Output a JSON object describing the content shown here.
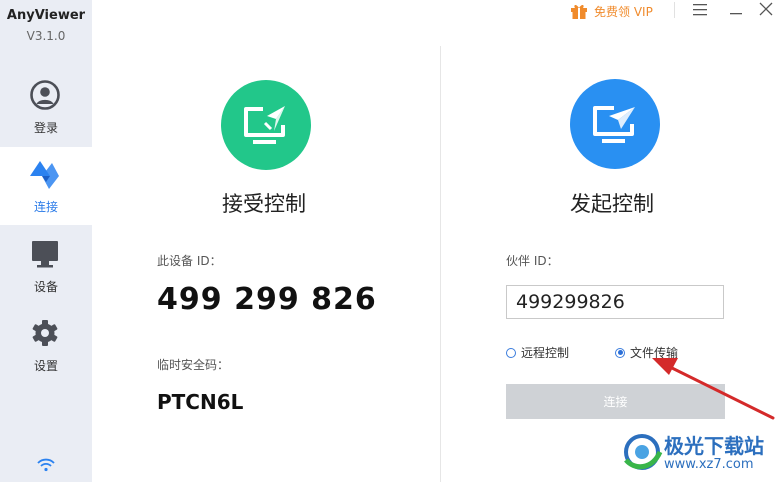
{
  "app": {
    "name": "AnyViewer",
    "version": "V3.1.0"
  },
  "topbar": {
    "vip_label": "免费领 VIP"
  },
  "sidebar": {
    "items": [
      {
        "label": "登录",
        "icon": "user-icon"
      },
      {
        "label": "连接",
        "icon": "connect-icon"
      },
      {
        "label": "设备",
        "icon": "monitor-icon"
      },
      {
        "label": "设置",
        "icon": "gear-icon"
      }
    ],
    "active": "连接"
  },
  "receive": {
    "title": "接受控制",
    "device_id_label": "此设备 ID：",
    "device_id": "499 299 826",
    "temp_code_label": "临时安全码：",
    "temp_code": "PTCN6L"
  },
  "initiate": {
    "title": "发起控制",
    "partner_id_label": "伙伴 ID：",
    "partner_id_value": "499299826",
    "options": [
      {
        "label": "远程控制",
        "selected": false
      },
      {
        "label": "文件传输",
        "selected": true
      }
    ],
    "connect_label": "连接"
  },
  "watermark": {
    "title": "极光下载站",
    "url": "www.xz7.com"
  },
  "colors": {
    "green": "#22c78a",
    "blue": "#2990f2",
    "accent": "#2b7be8",
    "vip": "#f08b2c",
    "arrow": "#d42a2a"
  }
}
